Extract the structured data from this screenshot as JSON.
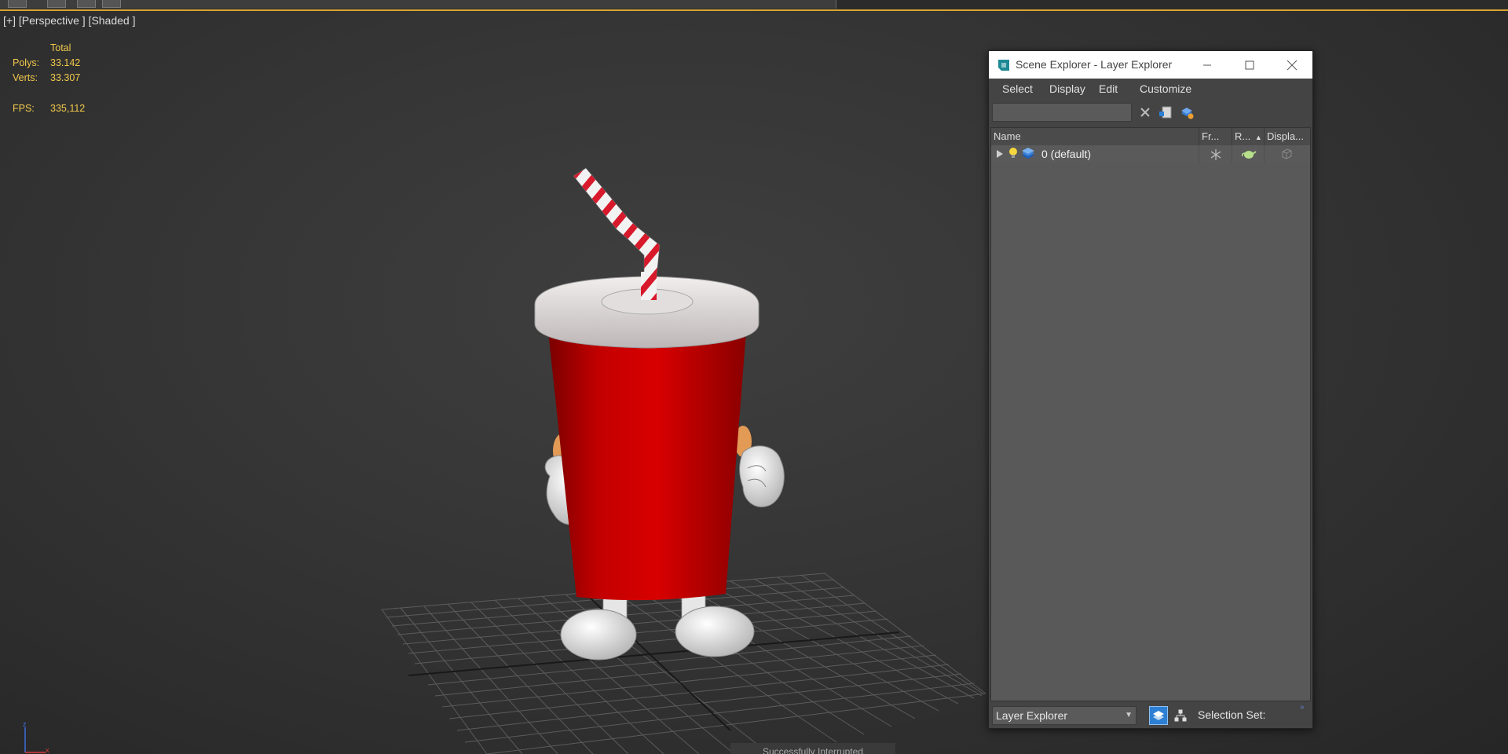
{
  "viewport": {
    "label": "[+] [Perspective ] [Shaded ]",
    "stats": {
      "total_label": "Total",
      "polys_label": "Polys:",
      "polys_value": "33.142",
      "verts_label": "Verts:",
      "verts_value": "33.307",
      "fps_label": "FPS:",
      "fps_value": "335,112"
    },
    "status_message": "Successfully Interrupted",
    "axis_labels": {
      "z": "z",
      "x": "x"
    }
  },
  "scene_explorer": {
    "title": "Scene Explorer - Layer Explorer",
    "menu": [
      "Select",
      "Display",
      "Edit",
      "Customize"
    ],
    "search_placeholder": "",
    "columns": {
      "name": "Name",
      "freeze": "Fr...",
      "render": "R...",
      "display": "Displa..."
    },
    "rows": [
      {
        "name": "0 (default)"
      }
    ],
    "bottom": {
      "explorer_select": "Layer Explorer",
      "selection_set_label": "Selection Set:"
    },
    "icons": {
      "app": "3dsmax-logo-icon",
      "minimize": "minimize-icon",
      "maximize": "maximize-icon",
      "close": "close-icon",
      "clear": "clear-search-icon",
      "new_layer": "new-layer-icon",
      "add_to_layer": "add-to-layer-icon"
    },
    "colors": {
      "accent": "#2d7fd3",
      "title_bg": "#ffffff",
      "panel_bg": "#444444"
    }
  }
}
